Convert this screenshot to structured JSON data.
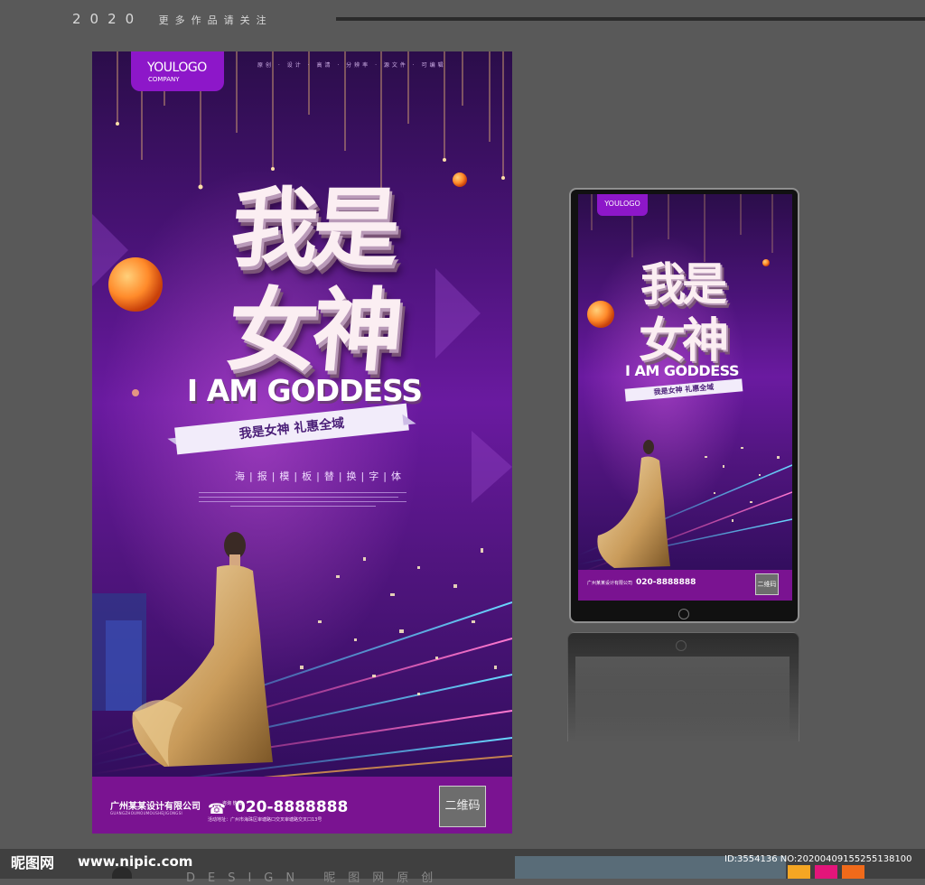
{
  "header": {
    "year": "2020",
    "subtitle": "更多作品请关注"
  },
  "poster": {
    "logo_main": "YOULOGO",
    "logo_sub": "COMPANY",
    "top_tags": "原创 · 设计 · 高清 · 分辨率 · 源文件 · 可编辑",
    "title_line1": "我是",
    "title_line2": "女神",
    "title_en": "I AM GODDESS",
    "ribbon": "我是女神 礼惠全域",
    "subtext": "海|报|模|板|替|换|字|体",
    "company": "广州某某设计有限公司",
    "company_en": "GUANGZHOUMOUMOUSHEJIGONGSI",
    "phone_small": "咨询 热线",
    "phone": "020-8888888",
    "address": "活动地址：广州市海珠区审塘路口交叉审塘路交叉口13号",
    "qr": "二维码"
  },
  "mockup": {
    "logo": "YOULOGO",
    "title_line1": "我是",
    "title_line2": "女神",
    "title_en": "I AM GODDESS",
    "ribbon": "我是女神 礼惠全域",
    "company": "广州某某设计有限公司",
    "phone": "020-8888888",
    "qr": "二维码"
  },
  "watermark": {
    "logo": "昵图网",
    "url": "www.nipic.com",
    "design": "DESIGN 昵图网原创",
    "id": "ID:3554136 NO:20200409155255138100"
  },
  "colors": {
    "background": "#595959",
    "purple": "#7a1391",
    "logo": "#8d17c9"
  }
}
